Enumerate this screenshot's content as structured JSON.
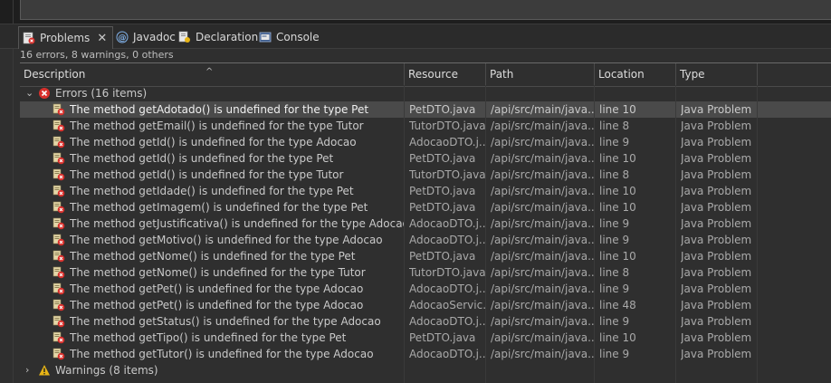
{
  "tabs": [
    {
      "label": "Problems",
      "icon": "problems-icon",
      "active": true
    },
    {
      "label": "Javadoc",
      "icon": "javadoc-icon"
    },
    {
      "label": "Declaration",
      "icon": "declaration-icon"
    },
    {
      "label": "Console",
      "icon": "console-icon"
    }
  ],
  "summary": "16 errors, 8 warnings, 0 others",
  "columns": {
    "description": "Description",
    "resource": "Resource",
    "path": "Path",
    "location": "Location",
    "type": "Type"
  },
  "groups": {
    "errors": "Errors (16 items)",
    "warnings": "Warnings (8 items)"
  },
  "rows": [
    {
      "desc": "The method getAdotado() is undefined for the type Pet",
      "res": "PetDTO.java",
      "path": "/api/src/main/java...",
      "loc": "line 10",
      "type": "Java Problem",
      "selected": true
    },
    {
      "desc": "The method getEmail() is undefined for the type Tutor",
      "res": "TutorDTO.java",
      "path": "/api/src/main/java...",
      "loc": "line 8",
      "type": "Java Problem"
    },
    {
      "desc": "The method getId() is undefined for the type Adocao",
      "res": "AdocaoDTO.j...",
      "path": "/api/src/main/java...",
      "loc": "line 9",
      "type": "Java Problem"
    },
    {
      "desc": "The method getId() is undefined for the type Pet",
      "res": "PetDTO.java",
      "path": "/api/src/main/java...",
      "loc": "line 10",
      "type": "Java Problem"
    },
    {
      "desc": "The method getId() is undefined for the type Tutor",
      "res": "TutorDTO.java",
      "path": "/api/src/main/java...",
      "loc": "line 8",
      "type": "Java Problem"
    },
    {
      "desc": "The method getIdade() is undefined for the type Pet",
      "res": "PetDTO.java",
      "path": "/api/src/main/java...",
      "loc": "line 10",
      "type": "Java Problem"
    },
    {
      "desc": "The method getImagem() is undefined for the type Pet",
      "res": "PetDTO.java",
      "path": "/api/src/main/java...",
      "loc": "line 10",
      "type": "Java Problem"
    },
    {
      "desc": "The method getJustificativa() is undefined for the type Adocao",
      "res": "AdocaoDTO.j...",
      "path": "/api/src/main/java...",
      "loc": "line 9",
      "type": "Java Problem"
    },
    {
      "desc": "The method getMotivo() is undefined for the type Adocao",
      "res": "AdocaoDTO.j...",
      "path": "/api/src/main/java...",
      "loc": "line 9",
      "type": "Java Problem"
    },
    {
      "desc": "The method getNome() is undefined for the type Pet",
      "res": "PetDTO.java",
      "path": "/api/src/main/java...",
      "loc": "line 10",
      "type": "Java Problem"
    },
    {
      "desc": "The method getNome() is undefined for the type Tutor",
      "res": "TutorDTO.java",
      "path": "/api/src/main/java...",
      "loc": "line 8",
      "type": "Java Problem"
    },
    {
      "desc": "The method getPet() is undefined for the type Adocao",
      "res": "AdocaoDTO.j...",
      "path": "/api/src/main/java...",
      "loc": "line 9",
      "type": "Java Problem"
    },
    {
      "desc": "The method getPet() is undefined for the type Adocao",
      "res": "AdocaoServic...",
      "path": "/api/src/main/java...",
      "loc": "line 48",
      "type": "Java Problem"
    },
    {
      "desc": "The method getStatus() is undefined for the type Adocao",
      "res": "AdocaoDTO.j...",
      "path": "/api/src/main/java...",
      "loc": "line 9",
      "type": "Java Problem"
    },
    {
      "desc": "The method getTipo() is undefined for the type Pet",
      "res": "PetDTO.java",
      "path": "/api/src/main/java...",
      "loc": "line 10",
      "type": "Java Problem"
    },
    {
      "desc": "The method getTutor() is undefined for the type Adocao",
      "res": "AdocaoDTO.j...",
      "path": "/api/src/main/java...",
      "loc": "line 9",
      "type": "Java Problem"
    }
  ],
  "colors": {
    "error": "#d9302c",
    "warning": "#e7b416",
    "selection": "#4a4a4a"
  }
}
